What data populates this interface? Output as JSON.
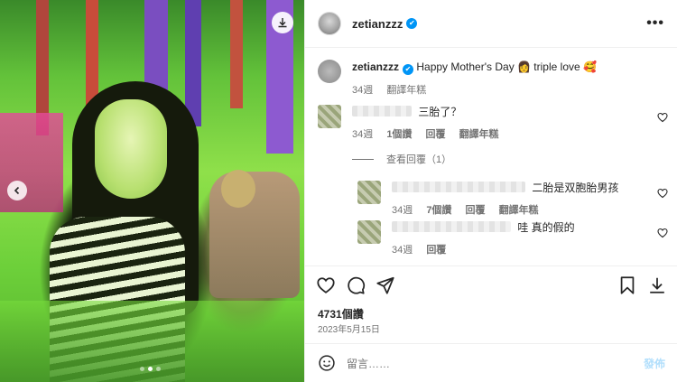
{
  "post": {
    "username": "zetianzzz",
    "verified_mark": "✔",
    "more_label": "•••"
  },
  "caption": {
    "username": "zetianzzz",
    "text": "Happy Mother's Day 👩 triple love 🥰",
    "time": "34週",
    "translate": "翻譯年糕"
  },
  "comments": [
    {
      "text": "三胎了？",
      "time": "34週",
      "likes": "1個讚",
      "reply": "回覆",
      "translate": "翻譯年糕"
    }
  ],
  "view_replies": "查看回覆（1）",
  "replies": [
    {
      "text": "二胎是双胞胎男孩",
      "time": "34週",
      "likes": "7個讚",
      "reply": "回覆",
      "translate": "翻譯年糕"
    },
    {
      "text": "哇 真的假的",
      "time": "34週",
      "reply": "回覆"
    }
  ],
  "stats": {
    "likes": "4731個讚",
    "date": "2023年5月15日"
  },
  "add_comment": {
    "placeholder": "留言……",
    "post_label": "發佈"
  },
  "icons": {
    "download": "download-icon",
    "prev": "chevron-left-icon",
    "like": "heart-icon",
    "comment": "comment-bubble-icon",
    "share": "paper-plane-icon",
    "save": "bookmark-icon",
    "emoji": "emoji-smile-icon"
  },
  "colors": {
    "verified": "#0095f6",
    "post_button_disabled": "#b2dffc",
    "secondary_text": "#737373"
  }
}
